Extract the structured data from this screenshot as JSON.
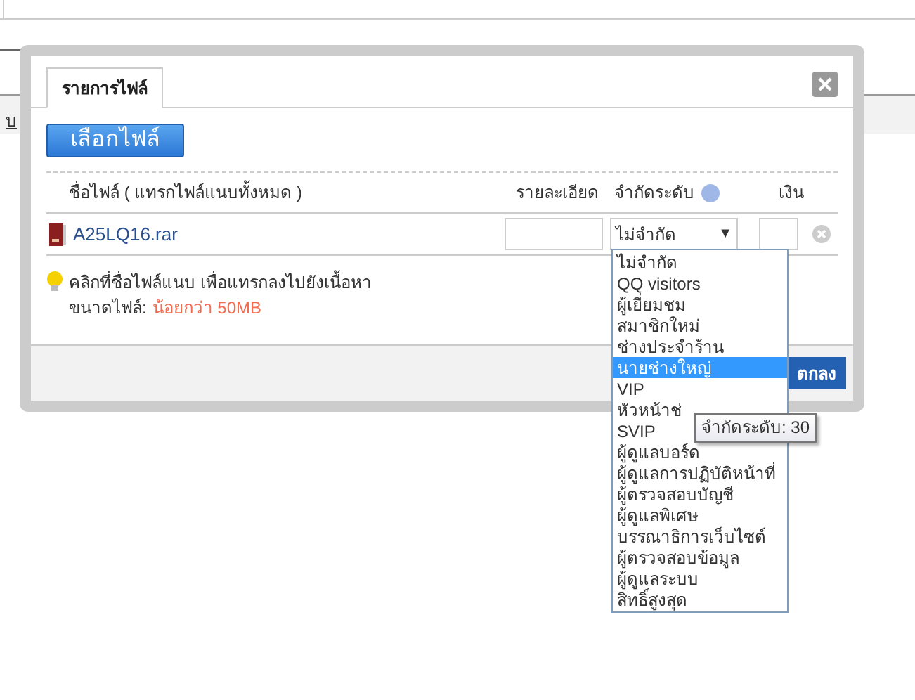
{
  "background": {
    "link_text": "บ"
  },
  "dialog": {
    "tabs": [
      {
        "label": "รายการไฟล์",
        "selected": true
      }
    ],
    "choose_button": "เลือกไฟล์",
    "table": {
      "columns": [
        "ชื่อไฟล์ ( แทรกไฟล์แนบทั้งหมด )",
        "รายละเอียด",
        "จำกัดระดับ",
        "เงิน"
      ],
      "rows": [
        {
          "file_name": "A25LQ16.rar",
          "limit": "ไม่จำกัด",
          "caret": "▼"
        }
      ]
    },
    "tip": {
      "line1": "คลิกที่ชื่อไฟล์แนบ เพื่อแทรกลงไปยังเนื้อหา",
      "size_label": "ขนาดไฟล์:",
      "size_value": "น้อยกว่า 50MB"
    },
    "ok_button": "ตกลง"
  },
  "dropdown": {
    "options": [
      {
        "label": "ไม่จำกัด",
        "selected": false
      },
      {
        "label": "QQ visitors",
        "selected": false
      },
      {
        "label": "ผู้เยี่ยมชม",
        "selected": false
      },
      {
        "label": "สมาชิกใหม่",
        "selected": false
      },
      {
        "label": "ช่างประจำร้าน",
        "selected": false
      },
      {
        "label": "นายช่างใหญ่",
        "selected": true
      },
      {
        "label": "VIP",
        "selected": false
      },
      {
        "label": "หัวหน้าช่",
        "selected": false
      },
      {
        "label": "SVIP",
        "selected": false
      },
      {
        "label": "ผู้ดูแลบอร์ด",
        "selected": false
      },
      {
        "label": "ผู้ดูแลการปฏิบัติหน้าที่",
        "selected": false
      },
      {
        "label": "ผู้ตรวจสอบบัญชี",
        "selected": false
      },
      {
        "label": "ผู้ดูแลพิเศษ",
        "selected": false
      },
      {
        "label": "บรรณาธิการเว็บไซต์",
        "selected": false
      },
      {
        "label": "ผู้ตรวจสอบข้อมูล",
        "selected": false
      },
      {
        "label": "ผู้ดูแลระบบ",
        "selected": false
      },
      {
        "label": "สิทธิ์สูงสุด",
        "selected": false
      }
    ]
  },
  "tooltip": "จำกัดระดับ: 30"
}
